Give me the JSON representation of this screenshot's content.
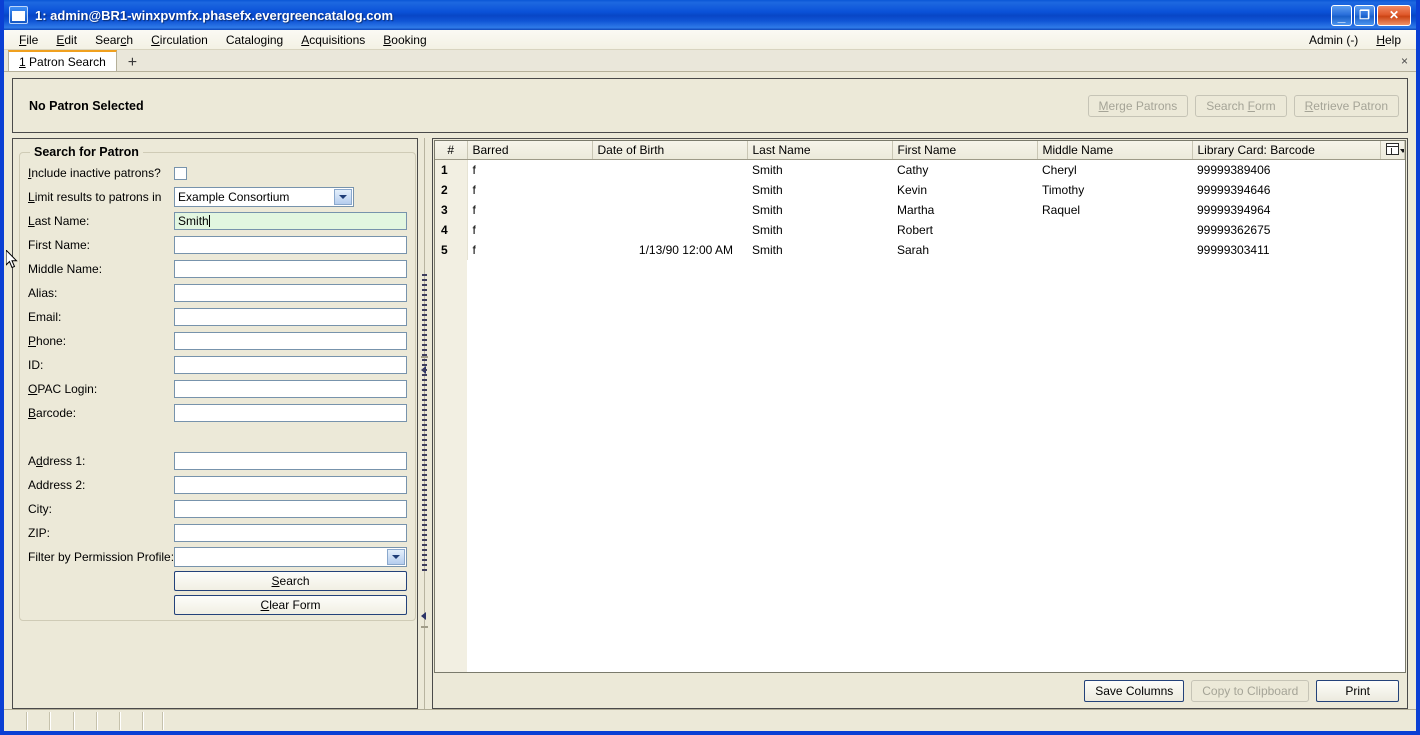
{
  "window": {
    "title": "1: admin@BR1-winxpvmfx.phasefx.evergreencatalog.com",
    "minimize_label": "_",
    "maximize_label": "❐",
    "close_label": "✕"
  },
  "menubar": {
    "items": [
      {
        "label": "File",
        "accel": "F"
      },
      {
        "label": "Edit",
        "accel": "E"
      },
      {
        "label": "Search",
        "accel": "c"
      },
      {
        "label": "Circulation",
        "accel": "C"
      },
      {
        "label": "Cataloging",
        "accel": "g"
      },
      {
        "label": "Acquisitions",
        "accel": "A"
      },
      {
        "label": "Booking",
        "accel": "B"
      }
    ],
    "right_items": [
      {
        "label": "Admin (-)"
      },
      {
        "label": "Help"
      }
    ]
  },
  "tabs": {
    "items": [
      {
        "number": "1",
        "label": "Patron Search"
      }
    ],
    "new_tab_label": "+",
    "close_label": "×"
  },
  "patron_band": {
    "title": "No Patron Selected",
    "buttons": [
      {
        "label": "Merge Patrons",
        "disabled": true
      },
      {
        "label": "Search Form",
        "disabled": true
      },
      {
        "label": "Retrieve Patron",
        "disabled": true
      }
    ]
  },
  "search_form": {
    "legend": "Search for Patron",
    "include_inactive_label": "Include inactive patrons?",
    "include_inactive_checked": false,
    "limit_label": "Limit results to patrons in",
    "limit_value": "Example Consortium",
    "fields": [
      {
        "label": "Last Name:",
        "value": "Smith",
        "active": true
      },
      {
        "label": "First Name:",
        "value": "",
        "active": false
      },
      {
        "label": "Middle Name:",
        "value": "",
        "active": false
      },
      {
        "label": "Alias:",
        "value": "",
        "active": false
      },
      {
        "label": "Email:",
        "value": "",
        "active": false
      },
      {
        "label": "Phone:",
        "value": "",
        "active": false
      },
      {
        "label": "ID:",
        "value": "",
        "active": false
      },
      {
        "label": "OPAC Login:",
        "value": "",
        "active": false
      },
      {
        "label": "Barcode:",
        "value": "",
        "active": false
      }
    ],
    "address_fields": [
      {
        "label": "Address 1:",
        "value": ""
      },
      {
        "label": "Address 2:",
        "value": ""
      },
      {
        "label": "City:",
        "value": ""
      },
      {
        "label": "ZIP:",
        "value": ""
      }
    ],
    "permission_label": "Filter by Permission Profile:",
    "permission_value": "",
    "search_button": "Search",
    "clear_button": "Clear Form"
  },
  "results": {
    "columns": [
      "#",
      "Barred",
      "Date of Birth",
      "Last Name",
      "First Name",
      "Middle Name",
      "Library Card: Barcode"
    ],
    "rows": [
      {
        "num": "1",
        "barred": "f",
        "dob": "",
        "last": "Smith",
        "first": "Cathy",
        "middle": "Cheryl",
        "card": "99999389406"
      },
      {
        "num": "2",
        "barred": "f",
        "dob": "",
        "last": "Smith",
        "first": "Kevin",
        "middle": "Timothy",
        "card": "99999394646"
      },
      {
        "num": "3",
        "barred": "f",
        "dob": "",
        "last": "Smith",
        "first": "Martha",
        "middle": "Raquel",
        "card": "99999394964"
      },
      {
        "num": "4",
        "barred": "f",
        "dob": "",
        "last": "Smith",
        "first": "Robert",
        "middle": "",
        "card": "99999362675"
      },
      {
        "num": "5",
        "barred": "f",
        "dob": "1/13/90 12:00 AM",
        "last": "Smith",
        "first": "Sarah",
        "middle": "",
        "card": "99999303411"
      }
    ],
    "footer_buttons": [
      {
        "label": "Save Columns",
        "disabled": false
      },
      {
        "label": "Copy to Clipboard",
        "disabled": true
      },
      {
        "label": "Print",
        "disabled": false
      }
    ]
  },
  "colors": {
    "titlebar_blue": "#0a51d8",
    "window_border": "#0a3fd4",
    "chrome_beige": "#ece9d8",
    "active_field_green": "#e2f6e0",
    "tab_accent_orange": "#f0a01e"
  }
}
